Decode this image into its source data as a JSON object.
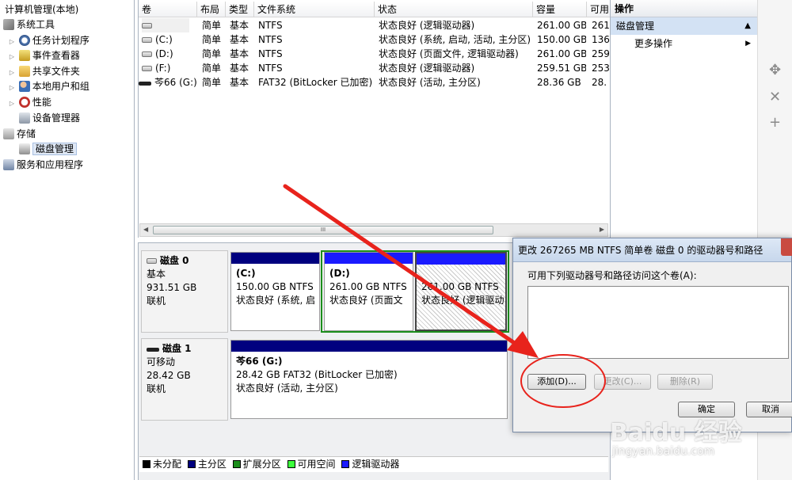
{
  "tree": {
    "items": [
      {
        "label": "计算机管理(本地)"
      },
      {
        "label": "系统工具"
      },
      {
        "label": "任务计划程序"
      },
      {
        "label": "事件查看器"
      },
      {
        "label": "共享文件夹"
      },
      {
        "label": "本地用户和组"
      },
      {
        "label": "性能"
      },
      {
        "label": "设备管理器"
      },
      {
        "label": "存储"
      },
      {
        "label": "磁盘管理"
      },
      {
        "label": "服务和应用程序"
      }
    ]
  },
  "volumes": {
    "headers": [
      "卷",
      "布局",
      "类型",
      "文件系统",
      "状态",
      "容量",
      "可用"
    ],
    "rows": [
      {
        "vol": "",
        "layout": "简单",
        "type": "基本",
        "fs": "NTFS",
        "status": "状态良好 (逻辑驱动器)",
        "cap": "261.00 GB",
        "free": "261"
      },
      {
        "vol": "(C:)",
        "layout": "简单",
        "type": "基本",
        "fs": "NTFS",
        "status": "状态良好 (系统, 启动, 活动, 主分区)",
        "cap": "150.00 GB",
        "free": "136"
      },
      {
        "vol": "(D:)",
        "layout": "简单",
        "type": "基本",
        "fs": "NTFS",
        "status": "状态良好 (页面文件, 逻辑驱动器)",
        "cap": "261.00 GB",
        "free": "259"
      },
      {
        "vol": "(F:)",
        "layout": "简单",
        "type": "基本",
        "fs": "NTFS",
        "status": "状态良好 (逻辑驱动器)",
        "cap": "259.51 GB",
        "free": "253"
      },
      {
        "vol": "芩66 (G:)",
        "layout": "简单",
        "type": "基本",
        "fs": "FAT32 (BitLocker 已加密)",
        "status": "状态良好 (活动, 主分区)",
        "cap": "28.36 GB",
        "free": "28."
      }
    ],
    "scroll_grip": "III"
  },
  "disks": [
    {
      "name": "磁盘 0",
      "kind": "基本",
      "size": "931.51 GB",
      "state": "联机"
    },
    {
      "name": "磁盘 1",
      "kind": "可移动",
      "size": "28.42 GB",
      "state": "联机"
    }
  ],
  "partitions": {
    "c": {
      "title": "(C:)",
      "line1": "150.00 GB NTFS",
      "line2": "状态良好 (系统, 启"
    },
    "d": {
      "title": "(D:)",
      "line1": "261.00 GB NTFS",
      "line2": "状态良好 (页面文"
    },
    "e": {
      "title": "",
      "line1": "261.00 GB NTFS",
      "line2": "状态良好 (逻辑驱动"
    },
    "g": {
      "title": "芩66  (G:)",
      "line1": "28.42 GB FAT32 (BitLocker 已加密)",
      "line2": "状态良好 (活动, 主分区)"
    }
  },
  "legend": [
    {
      "label": "未分配",
      "color": "#000000"
    },
    {
      "label": "主分区",
      "color": "#00007f"
    },
    {
      "label": "扩展分区",
      "color": "#1c8e1c"
    },
    {
      "label": "可用空间",
      "color": "#3cff3c"
    },
    {
      "label": "逻辑驱动器",
      "color": "#1a1aff"
    }
  ],
  "actions": {
    "title": "操作",
    "section": "磁盘管理",
    "more": "更多操作"
  },
  "dialog": {
    "title": "更改 267265 MB NTFS 简单卷 磁盘 0 的驱动器号和路径",
    "prompt": "可用下列驱动器号和路径访问这个卷(A):",
    "add": "添加(D)...",
    "change": "更改(C)...",
    "delete": "删除(R)",
    "ok": "确定",
    "cancel": "取消"
  },
  "watermark": {
    "brand": "Baidu 经验",
    "url": "jingyan.baidu.com"
  },
  "colors": {
    "primary": "#00007f",
    "logical": "#1a1aff",
    "extended": "#1c8e1c",
    "annotation": "#e8231c"
  }
}
